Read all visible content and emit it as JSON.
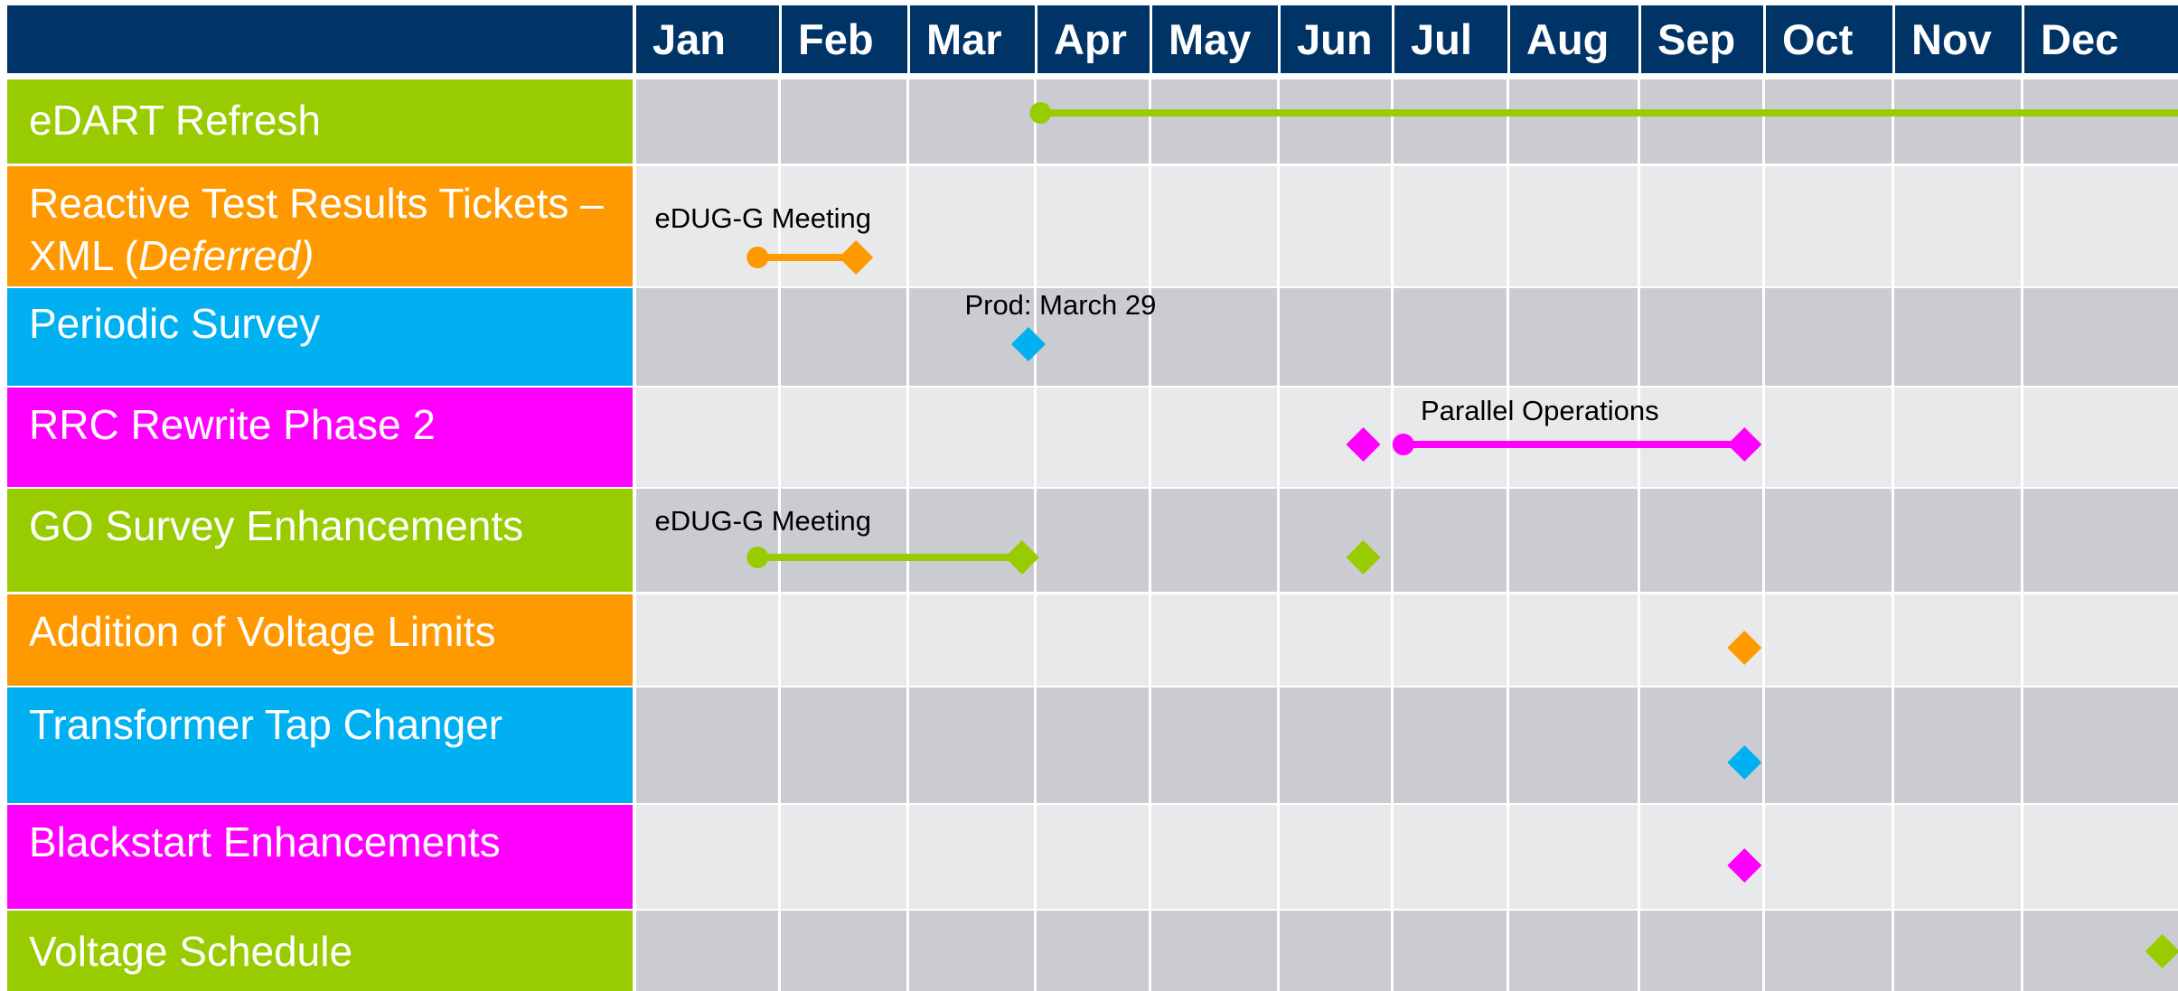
{
  "chart_data": {
    "type": "gantt",
    "months": [
      "Jan",
      "Feb",
      "Mar",
      "Apr",
      "May",
      "Jun",
      "Jul",
      "Aug",
      "Sep",
      "Oct",
      "Nov",
      "Dec"
    ],
    "colors": {
      "green": "#99CC00",
      "orange": "#FF9900",
      "blue": "#00B0F0",
      "magenta": "#FF00FF",
      "header": "#003366",
      "row_dark": "#CBCCD1",
      "row_light": "#E8E9EA"
    },
    "tasks": [
      {
        "label": "eDART Refresh",
        "color": "green",
        "bars": [
          {
            "start": 3.05,
            "end": 12.0,
            "start_marker": "circle",
            "end_marker": "none"
          }
        ],
        "milestones": [],
        "annotations": []
      },
      {
        "label": "Reactive Test Results Tickets – XML (",
        "label_italic": "Deferred)",
        "color": "orange",
        "bars": [
          {
            "start": 0.85,
            "end": 1.6,
            "start_marker": "circle",
            "end_marker": "diamond"
          }
        ],
        "milestones": [],
        "annotations": [
          {
            "text": "eDUG-G Meeting",
            "x": 0.13
          }
        ]
      },
      {
        "label": "Periodic Survey",
        "color": "blue",
        "bars": [],
        "milestones": [
          {
            "x": 2.95
          }
        ],
        "annotations": [
          {
            "text": "Prod: March 29",
            "x": 2.45
          }
        ]
      },
      {
        "label": "RRC Rewrite Phase 2",
        "color": "magenta",
        "bars": [
          {
            "start": 6.1,
            "end": 8.85,
            "start_marker": "circle",
            "end_marker": "diamond"
          }
        ],
        "milestones": [
          {
            "x": 5.75
          }
        ],
        "annotations": [
          {
            "text": "Parallel Operations",
            "x": 6.25
          }
        ]
      },
      {
        "label": "GO Survey Enhancements",
        "color": "green",
        "bars": [
          {
            "start": 0.85,
            "end": 2.9,
            "start_marker": "circle",
            "end_marker": "diamond"
          }
        ],
        "milestones": [
          {
            "x": 5.75
          }
        ],
        "annotations": [
          {
            "text": "eDUG-G Meeting",
            "x": 0.13
          }
        ]
      },
      {
        "label": "Addition of Voltage Limits",
        "color": "orange",
        "bars": [],
        "milestones": [
          {
            "x": 8.85
          }
        ],
        "annotations": []
      },
      {
        "label": "Transformer Tap Changer",
        "color": "blue",
        "bars": [],
        "milestones": [
          {
            "x": 8.85
          }
        ],
        "annotations": []
      },
      {
        "label": "Blackstart Enhancements",
        "color": "magenta",
        "bars": [],
        "milestones": [
          {
            "x": 8.85
          }
        ],
        "annotations": []
      },
      {
        "label": "Voltage Schedule",
        "color": "green",
        "bars": [],
        "milestones": [
          {
            "x": 11.9
          }
        ],
        "annotations": []
      }
    ]
  }
}
